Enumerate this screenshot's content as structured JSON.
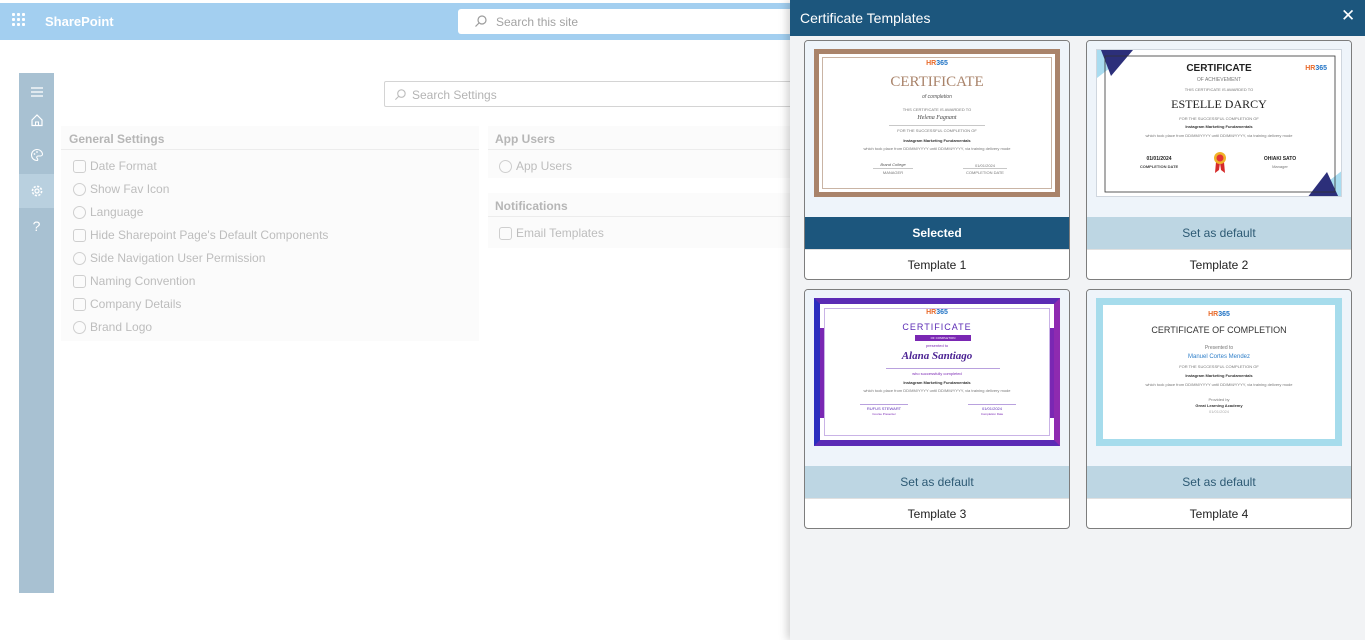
{
  "topbar": {
    "brand": "SharePoint",
    "search_placeholder": "Search this site"
  },
  "rail": {
    "icons": [
      "menu-icon",
      "home-icon",
      "palette-icon",
      "gear-icon",
      "help-icon"
    ]
  },
  "settings": {
    "search_placeholder": "Search Settings",
    "general": {
      "title": "General Settings",
      "items": [
        "Date Format",
        "Show Fav Icon",
        "Language",
        "Hide Sharepoint Page's Default Components",
        "Side Navigation User Permission",
        "Naming Convention",
        "Company Details",
        "Brand Logo"
      ]
    },
    "app_users": {
      "title": "App Users",
      "items": [
        "App Users"
      ]
    },
    "notifications": {
      "title": "Notifications",
      "items": [
        "Email Templates"
      ]
    }
  },
  "panel": {
    "title": "Certificate Templates",
    "close_glyph": "✕",
    "templates": [
      {
        "name": "Template 1",
        "action": "Selected",
        "selected": true,
        "thumb": {
          "logo_a": "HR",
          "logo_b": "365",
          "heading": "CERTIFICATE",
          "sub": "of completion",
          "line1": "THIS CERTIFICATE IS AWARDED TO",
          "recipient": "Helena Fagnant",
          "line2": "FOR THE SUCCESSFUL COMPLETION OF",
          "course": "Instagram Marketing Fundamentals",
          "line3": "which took place from DD/MM/YYYY until DD/MM/YYYY, via training delivery mode",
          "sig_name": "Brand College",
          "sig_role": "MANAGER",
          "date": "01/01/2024",
          "date_label": "COMPLETION DATE"
        }
      },
      {
        "name": "Template 2",
        "action": "Set as default",
        "selected": false,
        "thumb": {
          "logo_a": "HR",
          "logo_b": "365",
          "heading": "CERTIFICATE",
          "sub": "OF ACHIEVEMENT",
          "line1": "THIS CERTIFICATE IS AWARDED TO",
          "recipient": "ESTELLE DARCY",
          "line2": "FOR THE SUCCESSFUL COMPLETION OF",
          "course": "Instagram Marketing Fundamentals",
          "line3": "which took place from DD/MM/YYYY until DD/MM/YYYY, via training delivery mode",
          "date": "01/01/2024",
          "date_label": "COMPLETION DATE",
          "sig_name": "OHIAKI SATO",
          "sig_role": "Manager"
        }
      },
      {
        "name": "Template 3",
        "action": "Set as default",
        "selected": false,
        "thumb": {
          "logo_a": "HR",
          "logo_b": "365",
          "heading": "CERTIFICATE",
          "sub": "OF COMPLETION",
          "line1": "presented to",
          "recipient": "Alana Santiago",
          "line2": "who successfully completed",
          "course": "Instagram Marketing Fundamentals",
          "line3": "which took place from DD/MM/YYYY until DD/MM/YYYY, via training delivery mode",
          "sig_name": "RUFUS STEWART",
          "sig_role": "Course Presenter",
          "date": "01/01/2024",
          "date_label": "Completion Date"
        }
      },
      {
        "name": "Template 4",
        "action": "Set as default",
        "selected": false,
        "thumb": {
          "logo_a": "HR",
          "logo_b": "365",
          "heading": "CERTIFICATE OF COMPLETION",
          "line1": "Presented to",
          "recipient": "Manuel Cortes Mendez",
          "line2": "FOR THE SUCCESSFUL COMPLETION OF",
          "course": "Instagram Marketing Fundamentals",
          "line3": "which took place from DD/MM/YYYY until DD/MM/YYYY, via training delivery mode",
          "line4": "Provided by",
          "org": "Great Learning Academy",
          "date": "01/01/2024"
        }
      }
    ]
  },
  "colors": {
    "header": "#1c567d",
    "topbar": "#a3cff0",
    "rail": "#a8c1d2",
    "default_button": "#bdd6e3"
  }
}
